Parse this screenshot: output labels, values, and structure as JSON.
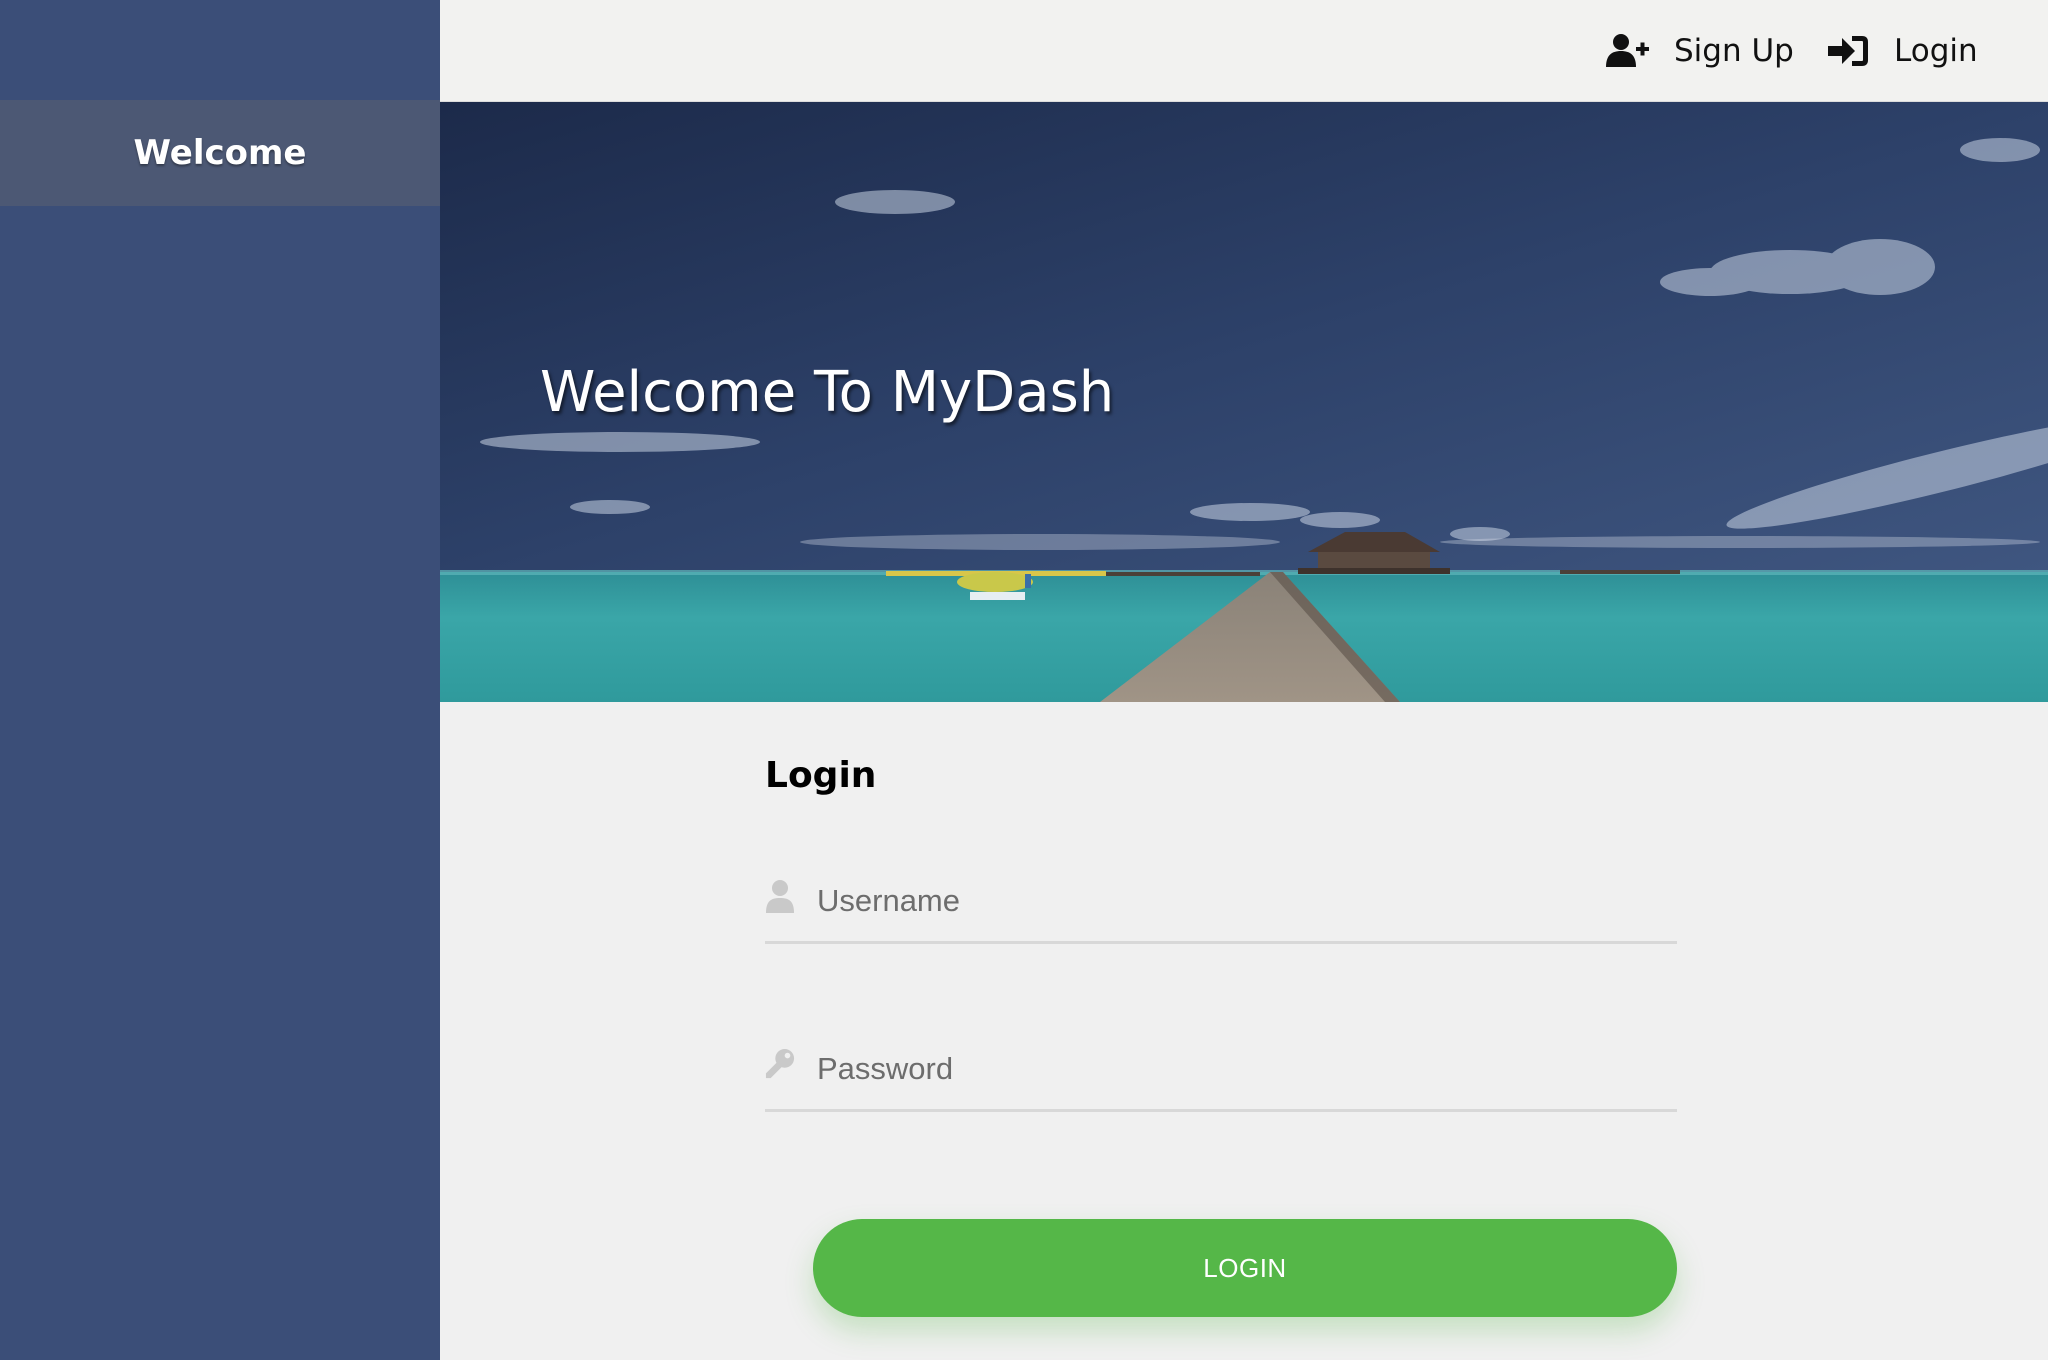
{
  "sidebar": {
    "items": [
      {
        "label": "Welcome"
      }
    ]
  },
  "topnav": {
    "signup_label": "Sign Up",
    "signup_icon": "user-plus-icon",
    "login_label": "Login",
    "login_icon": "sign-in-icon"
  },
  "hero": {
    "title": "Welcome To MyDash"
  },
  "login_form": {
    "heading": "Login",
    "username_placeholder": "Username",
    "username_value": "",
    "username_icon": "user-icon",
    "password_placeholder": "Password",
    "password_value": "",
    "password_icon": "key-icon",
    "submit_label": "LOGIN"
  },
  "colors": {
    "sidebar_bg": "#3b4e78",
    "sidebar_active_bg": "#4c5874",
    "topbar_bg": "#f2f2f0",
    "page_bg": "#f0f0f0",
    "button_green": "#55b748"
  }
}
